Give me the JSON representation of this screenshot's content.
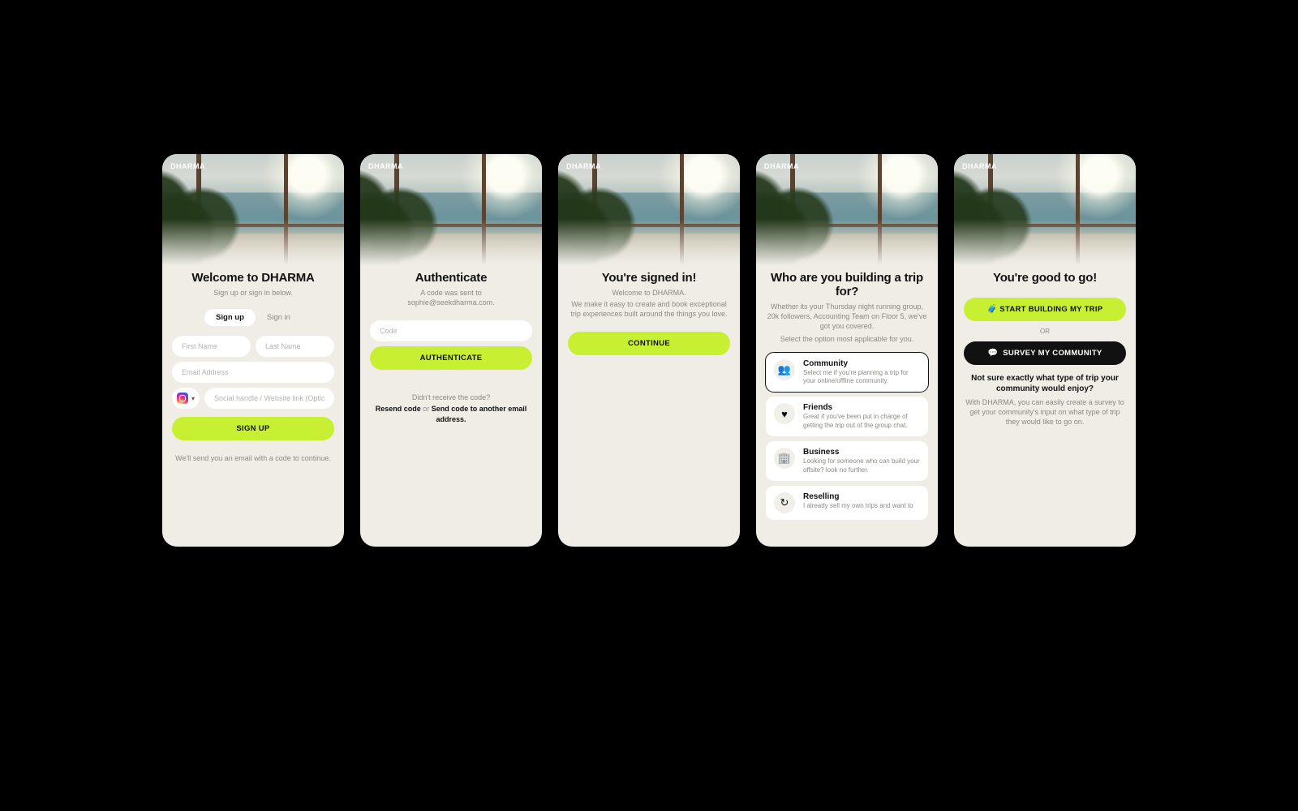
{
  "brand": "DHARMA",
  "screen1": {
    "title": "Welcome to DHARMA",
    "subtitle": "Sign up or sign in below.",
    "tab_signup": "Sign up",
    "tab_signin": "Sign in",
    "first_name_ph": "First Name",
    "last_name_ph": "Last Name",
    "email_ph": "Email Address",
    "social_ph": "Social handle / Website link (Optional)",
    "cta": "SIGN UP",
    "footnote": "We'll send you an email with a code to continue."
  },
  "screen2": {
    "title": "Authenticate",
    "sub1": "A code was sent to",
    "sub2": "sophie@seekdharma.com.",
    "code_ph": "Code",
    "cta": "AUTHENTICATE",
    "no_code": "Didn't receive the code?",
    "resend": "Resend code",
    "or": " or ",
    "another": "Send code to another email address."
  },
  "screen3": {
    "title": "You're signed in!",
    "sub1": "Welcome to DHARMA.",
    "sub2": "We make it easy to create and book exceptional trip experiences built around the things you love.",
    "cta": "CONTINUE"
  },
  "screen4": {
    "title": "Who are you building a trip for?",
    "sub1": "Whether its your Thursday night running group, 20k followers, Accounting Team on Floor 5, we've got you covered.",
    "sub2": "Select the option most applicable for you.",
    "options": [
      {
        "name": "Community",
        "desc": "Select me if you're planning a trip for your online/offline community.",
        "icon": "👥"
      },
      {
        "name": "Friends",
        "desc": "Great if you've been put in charge of getting the trip out of the group chat.",
        "icon": "♥"
      },
      {
        "name": "Business",
        "desc": "Looking for someone who can build your offsite? look no further.",
        "icon": "🏢"
      },
      {
        "name": "Reselling",
        "desc": "I already sell my own trips and want to",
        "icon": "↻"
      }
    ]
  },
  "screen5": {
    "title": "You're good to go!",
    "cta1": "START BUILDING MY TRIP",
    "or": "OR",
    "cta2": "SURVEY MY COMMUNITY",
    "q": "Not sure exactly what type of trip your community would enjoy?",
    "desc": "With DHARMA, you can easily create a survey to get your community's input on what type of trip they would like to go on."
  }
}
